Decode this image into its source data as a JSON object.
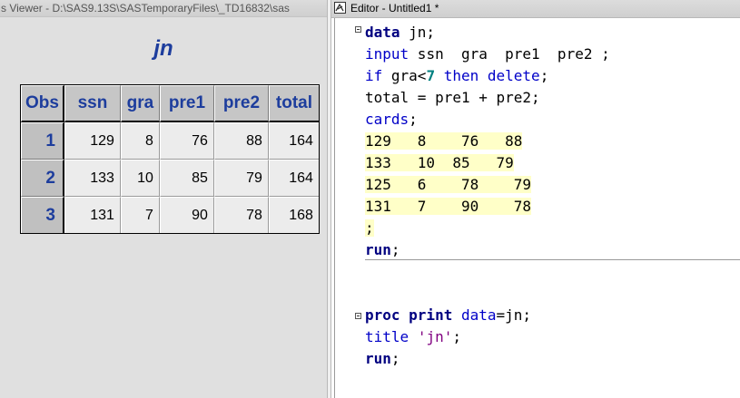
{
  "results_viewer": {
    "title_text": "s Viewer - D:\\SAS9.13S\\SASTemporaryFiles\\_TD16832\\sas",
    "report_title": "jn",
    "table": {
      "columns": [
        "Obs",
        "ssn",
        "gra",
        "pre1",
        "pre2",
        "total"
      ],
      "rows": [
        {
          "obs": "1",
          "ssn": "129",
          "gra": "8",
          "pre1": "76",
          "pre2": "88",
          "total": "164"
        },
        {
          "obs": "2",
          "ssn": "133",
          "gra": "10",
          "pre1": "85",
          "pre2": "79",
          "total": "164"
        },
        {
          "obs": "3",
          "ssn": "131",
          "gra": "7",
          "pre1": "90",
          "pre2": "78",
          "total": "168"
        }
      ]
    }
  },
  "editor": {
    "title_text": "Editor - Untitled1 *",
    "icon": "sas-editor-icon",
    "code": {
      "l1_kw": "data",
      "l1_rest": " jn;",
      "l2_kw": "input",
      "l2_rest": " ssn  gra  pre1  pre2 ;",
      "l3_kw1": "if",
      "l3_a": " gra<",
      "l3_num": "7",
      "l3_sp": " ",
      "l3_kw2": "then",
      "l3_sp2": " ",
      "l3_kw3": "delete",
      "l3_end": ";",
      "l4": "total = pre1 + pre2;",
      "l5_kw": "cards",
      "l5_end": ";",
      "d1": "129   8    76   88",
      "d2": "133   10  85   79",
      "d3": "125   6    78    79",
      "d4": "131   7    90    78",
      "d5": ";",
      "l6_kw": "run",
      "l6_end": ";",
      "p1_kw": "proc print",
      "p1_sp": " ",
      "p1_opt": "data",
      "p1_rest": "=jn;",
      "p2_kw": "title",
      "p2_sp": " ",
      "p2_str": "'jn'",
      "p2_end": ";",
      "p3_kw": "run",
      "p3_end": ";"
    }
  },
  "colors": {
    "keyword": "#0000c8",
    "keyword_bold": "#000080",
    "number": "#008080",
    "string": "#800080",
    "datalines_highlight": "#ffffc8",
    "report_header_text": "#1d3d9d"
  }
}
